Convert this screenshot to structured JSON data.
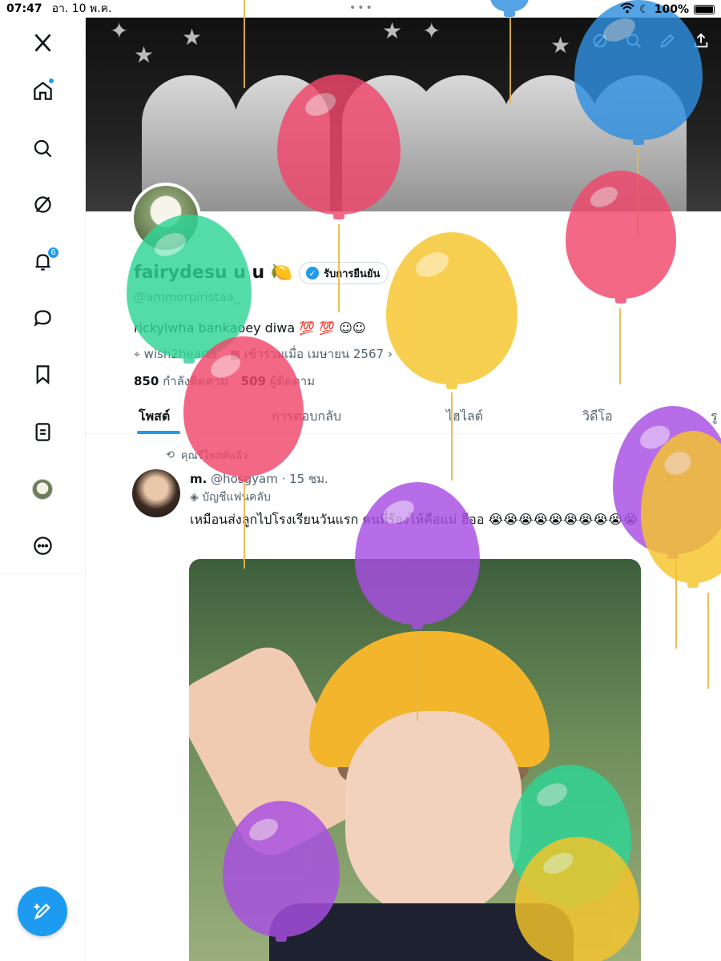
{
  "status_bar": {
    "time": "07:47",
    "date": "อา. 10 พ.ค.",
    "battery": "100%",
    "moon_icon": "moon-icon",
    "wifi_icon": "wifi-icon"
  },
  "sidebar": {
    "items": [
      {
        "name": "x-logo",
        "icon": "x-logo-icon"
      },
      {
        "name": "home",
        "icon": "home-icon"
      },
      {
        "name": "search",
        "icon": "search-icon"
      },
      {
        "name": "grok",
        "icon": "grok-icon"
      },
      {
        "name": "notifications",
        "icon": "bell-icon",
        "badge": "6"
      },
      {
        "name": "messages",
        "icon": "chat-icon"
      },
      {
        "name": "bookmarks",
        "icon": "bookmark-icon"
      },
      {
        "name": "lists",
        "icon": "list-icon"
      },
      {
        "name": "profile",
        "icon": "avatar-icon"
      },
      {
        "name": "more",
        "icon": "more-icon"
      }
    ],
    "compose_icon": "compose-icon"
  },
  "profile": {
    "display_name": "fairydesu u u 🍋",
    "verify_label": "รับการยืนยัน",
    "handle": "@ammorpiristaa_",
    "bio": "rickyiwha bankaoey diwa 💯 💯 ☺︎☺︎",
    "location": "wish2hearts",
    "joined": "เข้าร่วมเมื่อ เมษายน 2567",
    "following_count": "850",
    "following_label": "กำลังติดตาม",
    "followers_count": "509",
    "followers_label": "ผู้ติดตาม"
  },
  "tabs": [
    {
      "label": "โพสต์",
      "active": true
    },
    {
      "label": "การตอบกลับ",
      "active": false
    },
    {
      "label": "ไฮไลต์",
      "active": false
    },
    {
      "label": "วิดีโอ",
      "active": false
    },
    {
      "label": "รู",
      "active": false
    }
  ],
  "post": {
    "repost_label": "คุณรีโพสต์แล้ว",
    "author_name": "m.",
    "author_handle": "@hosgyam",
    "time": "· 15 ชม.",
    "fan_label": "บัญชีแฟนคลับ",
    "text": "เหมือนส่งลูกไปโรงเรียนวันแรก คนที่ร้องไห้คือแม่ ฮืออ 😭😭😭😭😭😭😭😭😭😭"
  },
  "colors": {
    "accent": "#1d9bf0",
    "balloon_pink": "#f0476b",
    "balloon_blue": "#2f8fe0",
    "balloon_green": "#2fd596",
    "balloon_yellow": "#f6c52a",
    "balloon_purple": "#a94ee3"
  }
}
